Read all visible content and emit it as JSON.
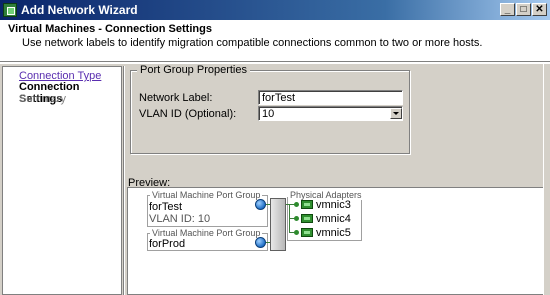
{
  "window": {
    "title": "Add Network Wizard",
    "buttons": {
      "minimize": "_",
      "maximize": "□",
      "close": "✕"
    }
  },
  "header": {
    "title": "Virtual Machines - Connection Settings",
    "description": "Use network labels to identify migration compatible connections common to two or more hosts."
  },
  "nav": {
    "items": [
      {
        "label": "Connection Type",
        "state": "link"
      },
      {
        "label": "Connection Settings",
        "state": "current"
      },
      {
        "label": "Summary",
        "state": "future"
      }
    ]
  },
  "port_group_properties": {
    "legend": "Port Group Properties",
    "network_label": {
      "label": "Network Label:",
      "value": "forTest"
    },
    "vlan_id": {
      "label": "VLAN ID (Optional):",
      "value": "10"
    }
  },
  "preview": {
    "label": "Preview:",
    "groups": [
      {
        "title": "Virtual Machine Port Group",
        "name": "forTest",
        "vlan": "VLAN ID: 10"
      },
      {
        "title": "Virtual Machine Port Group",
        "name": "forProd",
        "vlan": ""
      }
    ],
    "adapters": {
      "title": "Physical Adapters",
      "items": [
        "vmnic3",
        "vmnic4",
        "vmnic5"
      ]
    }
  },
  "colors": {
    "titlebar": "#0a246a",
    "link": "#5a2fb0",
    "wire": "#3a7d3a"
  },
  "icons": [
    "app-icon",
    "network-icon",
    "nic-icon"
  ]
}
